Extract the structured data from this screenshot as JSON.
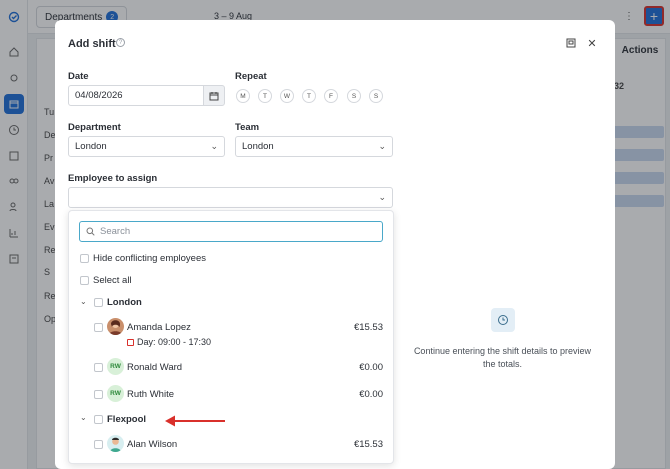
{
  "topbar": {
    "departments_label": "Departments",
    "departments_count": "2",
    "date_range": "3 – 9 Aug",
    "add_label": "+"
  },
  "background": {
    "actions_header": "Actions",
    "row_labels": [
      "Tu",
      "De",
      "Pr",
      "Av",
      "La",
      "Ev",
      "Re",
      "S",
      "Re",
      "Op"
    ],
    "number": "32"
  },
  "modal": {
    "title": "Add shift",
    "date_label": "Date",
    "date_value": "04/08/2026",
    "repeat_label": "Repeat",
    "weekdays": [
      "M",
      "T",
      "W",
      "T",
      "F",
      "S",
      "S"
    ],
    "department_label": "Department",
    "department_value": "London",
    "team_label": "Team",
    "team_value": "London",
    "employee_label": "Employee to assign",
    "employee_value": "",
    "hint": "Continue entering the shift details to preview the totals."
  },
  "dropdown": {
    "search_placeholder": "Search",
    "hide_conflicting": "Hide conflicting employees",
    "select_all": "Select all",
    "groups": [
      {
        "name": "London",
        "employees": [
          {
            "name": "Amanda Lopez",
            "rate": "€15.53",
            "conflict": "Day: 09:00 - 17:30",
            "avatar": "photo"
          },
          {
            "name": "Ronald Ward",
            "rate": "€0.00",
            "initials": "RW"
          },
          {
            "name": "Ruth White",
            "rate": "€0.00",
            "initials": "RW"
          }
        ]
      },
      {
        "name": "Flexpool",
        "employees": [
          {
            "name": "Alan Wilson",
            "rate": "€15.53",
            "avatar": "photo"
          }
        ]
      }
    ]
  },
  "colors": {
    "accent": "#1d6fd8",
    "highlight": "#d9302b",
    "focus": "#4aa8c9"
  }
}
